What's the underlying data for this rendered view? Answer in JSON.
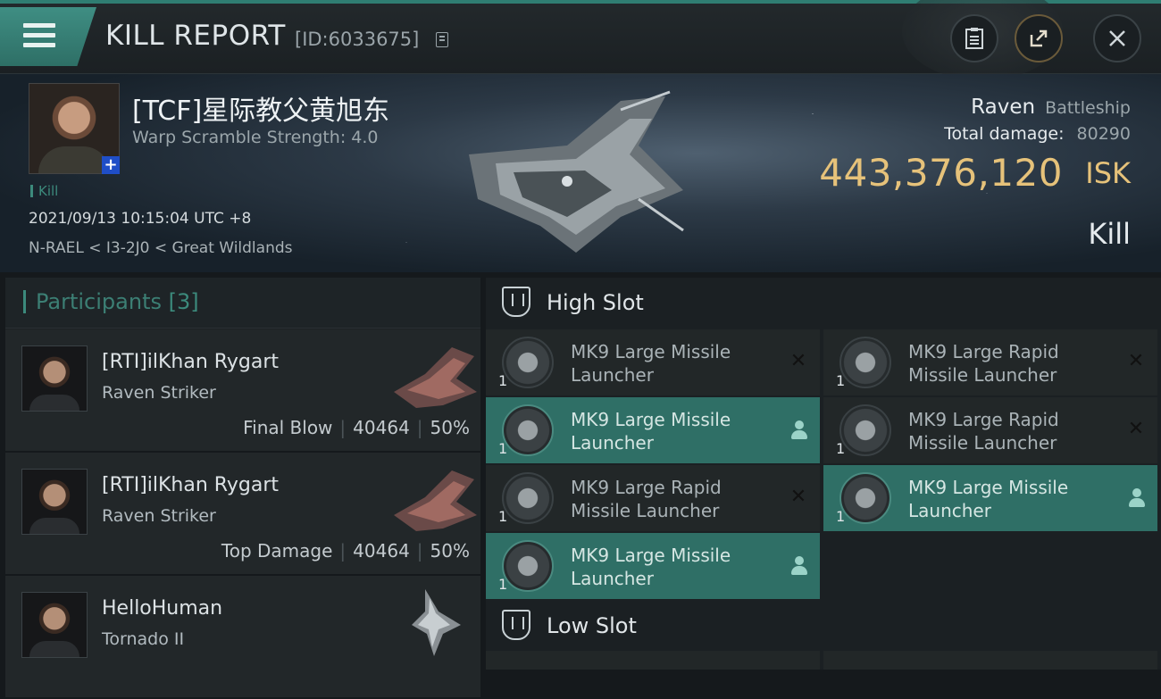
{
  "header": {
    "title": "KILL REPORT",
    "report_id": "[ID:6033675]",
    "icons": [
      "menu-icon",
      "copy-icon",
      "clipboard-icon",
      "share-icon",
      "close-icon"
    ]
  },
  "victim": {
    "name": "[TCF]星际教父黄旭东",
    "warp_scramble": "Warp Scramble Strength: 4.0",
    "kill_tag": "Kill",
    "datetime": "2021/09/13 10:15:04 UTC +8",
    "location": "N-RAEL < I3-2J0 < Great Wildlands",
    "ship_name": "Raven",
    "ship_class": "Battleship",
    "total_damage_label": "Total damage:",
    "total_damage": "80290",
    "isk_value": "443,376,120",
    "isk_unit": "ISK",
    "result": "Kill"
  },
  "participants": {
    "label": "Participants",
    "count": "[3]",
    "rows": [
      {
        "name": "[RTI]ilKhan Rygart",
        "ship": "Raven Striker",
        "role": "Final Blow",
        "damage": "40464",
        "percent": "50%"
      },
      {
        "name": "[RTI]ilKhan Rygart",
        "ship": "Raven Striker",
        "role": "Top Damage",
        "damage": "40464",
        "percent": "50%"
      },
      {
        "name": "HelloHuman",
        "ship": "Tornado II",
        "role": "",
        "damage": "",
        "percent": ""
      }
    ]
  },
  "fitting": {
    "high_slot_label": "High Slot",
    "low_slot_label": "Low Slot",
    "high_modules": [
      {
        "name": "MK9 Large Missile Launcher",
        "qty": "1",
        "state": "destroyed"
      },
      {
        "name": "MK9 Large Rapid Missile Launcher",
        "qty": "1",
        "state": "destroyed"
      },
      {
        "name": "MK9 Large Missile Launcher",
        "qty": "1",
        "state": "dropped"
      },
      {
        "name": "MK9 Large Rapid Missile Launcher",
        "qty": "1",
        "state": "destroyed"
      },
      {
        "name": "MK9 Large Rapid Missile Launcher",
        "qty": "1",
        "state": "destroyed"
      },
      {
        "name": "MK9 Large Missile Launcher",
        "qty": "1",
        "state": "dropped"
      },
      {
        "name": "MK9 Large Missile Launcher",
        "qty": "1",
        "state": "dropped"
      }
    ]
  },
  "colors": {
    "accent": "#3c8a7c",
    "isk": "#e6c27a",
    "active_module": "#2f6f66"
  }
}
